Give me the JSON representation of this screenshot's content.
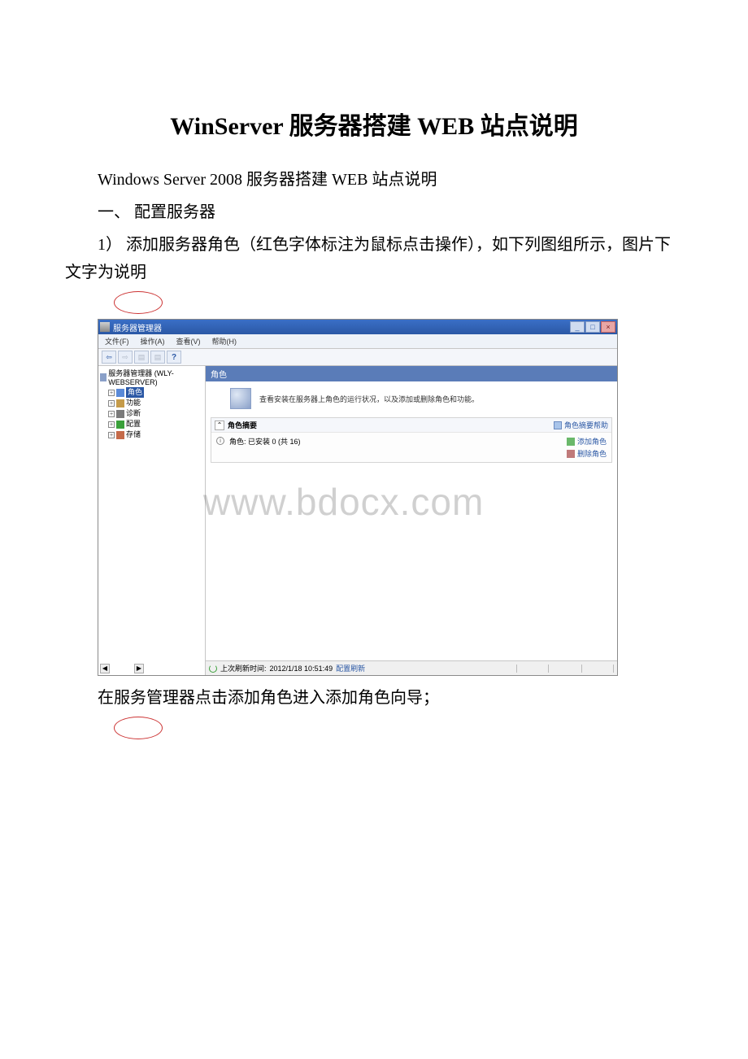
{
  "doc": {
    "title": "WinServer 服务器搭建 WEB 站点说明",
    "p1": "Windows Server 2008 服务器搭建 WEB 站点说明",
    "p2": "一、 配置服务器",
    "p3": "1） 添加服务器角色（红色字体标注为鼠标点击操作），如下列图组所示，图片下文字为说明",
    "p4": "在服务管理器点击添加角色进入添加角色向导；"
  },
  "watermark": "www.bdocx.com",
  "screenshot": {
    "window_title": "服务器管理器",
    "menu": {
      "file": "文件(F)",
      "action": "操作(A)",
      "view": "查看(V)",
      "help": "帮助(H)"
    },
    "tree": {
      "root": "服务器管理器 (WLY-WEBSERVER)",
      "items": [
        {
          "label": "角色",
          "selected": true
        },
        {
          "label": "功能"
        },
        {
          "label": "诊断"
        },
        {
          "label": "配置"
        },
        {
          "label": "存储"
        }
      ]
    },
    "panel": {
      "header": "角色",
      "description": "查看安装在服务器上角色的运行状况，以及添加或删除角色和功能。",
      "summary": {
        "title": "角色摘要",
        "help_link": "角色摘要帮助",
        "roles_line": "角色: 已安装 0 (共 16)",
        "add_role": "添加角色",
        "remove_role": "删除角色"
      }
    },
    "statusbar": {
      "last_refresh_label": "上次刷新时间:",
      "last_refresh_time": "2012/1/18 10:51:49",
      "configure_refresh": "配置刷新"
    },
    "win_buttons": {
      "min": "_",
      "max": "□",
      "close": "×"
    }
  }
}
